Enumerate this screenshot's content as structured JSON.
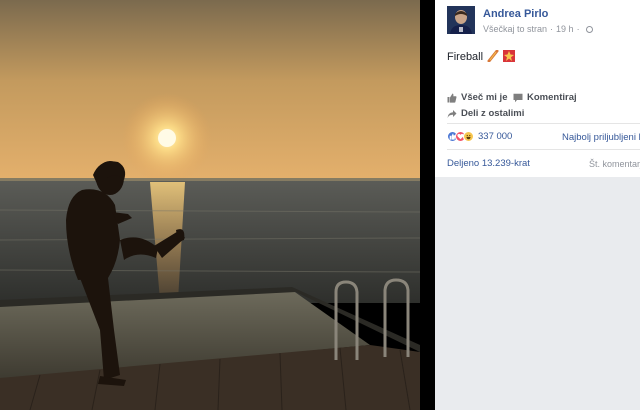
{
  "post": {
    "author": "Andrea Pirlo",
    "audience": "Všečkaj to stran",
    "time": "19 h",
    "text": "Fireball",
    "emoji_names": [
      "football-icon",
      "fire-explosion-icon"
    ]
  },
  "actions": {
    "like": "Všeč mi je",
    "comment": "Komentiraj",
    "share": "Deli z ostalimi"
  },
  "stats": {
    "reactions_count": "337 000",
    "reaction_types": [
      "like",
      "love",
      "haha"
    ],
    "top_comments_label": "Najbolj priljubljeni k",
    "shares": "Deljeno 13.239-krat",
    "comments_count": "Št. komentarj"
  },
  "colors": {
    "link": "#365899",
    "background": "#e9ebee",
    "like": "#4a76d4",
    "love": "#f25268",
    "haha": "#f7c64f"
  }
}
